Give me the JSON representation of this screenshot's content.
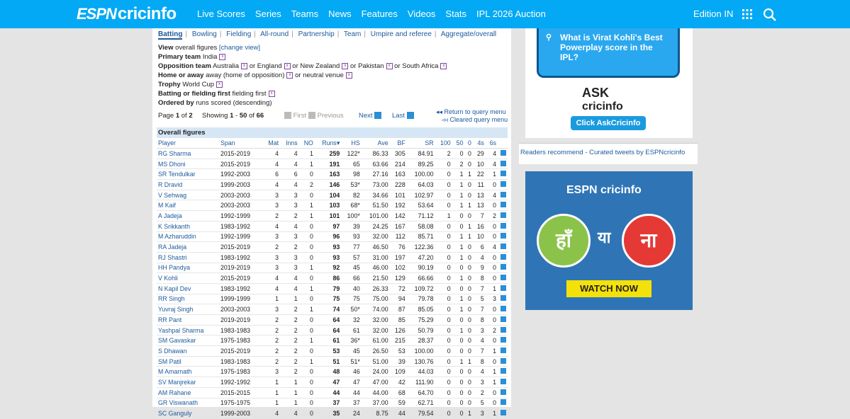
{
  "header": {
    "logo_espn": "ESPN",
    "logo_cricinfo": "cricinfo",
    "nav": [
      "Live Scores",
      "Series",
      "Teams",
      "News",
      "Features",
      "Videos",
      "Stats",
      "IPL 2026 Auction"
    ],
    "edition": "Edition IN"
  },
  "subnav": [
    "Batting",
    "Bowling",
    "Fielding",
    "All-round",
    "Partnership",
    "Team",
    "Umpire and referee",
    "Aggregate/overall"
  ],
  "query": {
    "view_label": "View",
    "view_value": "overall figures",
    "change_view": "[change view]",
    "primary_label": "Primary team",
    "primary_value": "India",
    "opp_label": "Opposition team",
    "opp_1": "Australia",
    "opp_2": "or England",
    "opp_3": "or New Zealand",
    "opp_4": "or Pakistan",
    "opp_5": "or South Africa",
    "home_label": "Home or away",
    "home_1": "away (home of opposition)",
    "home_2": "or neutral venue",
    "trophy_label": "Trophy",
    "trophy_value": "World Cup",
    "bf_label": "Batting or fielding first",
    "bf_value": "fielding first",
    "order_label": "Ordered by",
    "order_value": "runs scored (descending)"
  },
  "pager": {
    "page_label": "Page",
    "page": "1",
    "of": "of",
    "total_pages": "2",
    "showing": "Showing",
    "from": "1",
    "dash": "-",
    "to": "50",
    "of2": "of",
    "total": "66",
    "first": "First",
    "previous": "Previous",
    "next": "Next",
    "last": "Last",
    "return": "Return to query menu",
    "cleared": "Cleared query menu"
  },
  "table": {
    "section_title": "Overall figures",
    "columns": [
      "Player",
      "Span",
      "Mat",
      "Inns",
      "NO",
      "Runs",
      "HS",
      "Ave",
      "BF",
      "SR",
      "100",
      "50",
      "0",
      "4s",
      "6s"
    ],
    "rows": [
      [
        "RG Sharma",
        "2015-2019",
        "4",
        "4",
        "1",
        "259",
        "122*",
        "86.33",
        "305",
        "84.91",
        "2",
        "0",
        "0",
        "29",
        "4"
      ],
      [
        "MS Dhoni",
        "2015-2019",
        "4",
        "4",
        "1",
        "191",
        "65",
        "63.66",
        "214",
        "89.25",
        "0",
        "2",
        "0",
        "10",
        "4"
      ],
      [
        "SR Tendulkar",
        "1992-2003",
        "6",
        "6",
        "0",
        "163",
        "98",
        "27.16",
        "163",
        "100.00",
        "0",
        "1",
        "1",
        "22",
        "1"
      ],
      [
        "R Dravid",
        "1999-2003",
        "4",
        "4",
        "2",
        "146",
        "53*",
        "73.00",
        "228",
        "64.03",
        "0",
        "1",
        "0",
        "11",
        "0"
      ],
      [
        "V Sehwag",
        "2003-2003",
        "3",
        "3",
        "0",
        "104",
        "82",
        "34.66",
        "101",
        "102.97",
        "0",
        "1",
        "0",
        "13",
        "4"
      ],
      [
        "M Kaif",
        "2003-2003",
        "3",
        "3",
        "1",
        "103",
        "68*",
        "51.50",
        "192",
        "53.64",
        "0",
        "1",
        "1",
        "13",
        "0"
      ],
      [
        "A Jadeja",
        "1992-1999",
        "2",
        "2",
        "1",
        "101",
        "100*",
        "101.00",
        "142",
        "71.12",
        "1",
        "0",
        "0",
        "7",
        "2"
      ],
      [
        "K Srikkanth",
        "1983-1992",
        "4",
        "4",
        "0",
        "97",
        "39",
        "24.25",
        "167",
        "58.08",
        "0",
        "0",
        "1",
        "16",
        "0"
      ],
      [
        "M Azharuddin",
        "1992-1999",
        "3",
        "3",
        "0",
        "96",
        "93",
        "32.00",
        "112",
        "85.71",
        "0",
        "1",
        "1",
        "10",
        "0"
      ],
      [
        "RA Jadeja",
        "2015-2019",
        "2",
        "2",
        "0",
        "93",
        "77",
        "46.50",
        "76",
        "122.36",
        "0",
        "1",
        "0",
        "6",
        "4"
      ],
      [
        "RJ Shastri",
        "1983-1992",
        "3",
        "3",
        "0",
        "93",
        "57",
        "31.00",
        "197",
        "47.20",
        "0",
        "1",
        "0",
        "4",
        "0"
      ],
      [
        "HH Pandya",
        "2019-2019",
        "3",
        "3",
        "1",
        "92",
        "45",
        "46.00",
        "102",
        "90.19",
        "0",
        "0",
        "0",
        "9",
        "0"
      ],
      [
        "V Kohli",
        "2015-2019",
        "4",
        "4",
        "0",
        "86",
        "66",
        "21.50",
        "129",
        "66.66",
        "0",
        "1",
        "0",
        "8",
        "0"
      ],
      [
        "N Kapil Dev",
        "1983-1992",
        "4",
        "4",
        "1",
        "79",
        "40",
        "26.33",
        "72",
        "109.72",
        "0",
        "0",
        "0",
        "7",
        "1"
      ],
      [
        "RR Singh",
        "1999-1999",
        "1",
        "1",
        "0",
        "75",
        "75",
        "75.00",
        "94",
        "79.78",
        "0",
        "1",
        "0",
        "5",
        "3"
      ],
      [
        "Yuvraj Singh",
        "2003-2003",
        "3",
        "2",
        "1",
        "74",
        "50*",
        "74.00",
        "87",
        "85.05",
        "0",
        "1",
        "0",
        "7",
        "0"
      ],
      [
        "RR Pant",
        "2019-2019",
        "2",
        "2",
        "0",
        "64",
        "32",
        "32.00",
        "85",
        "75.29",
        "0",
        "0",
        "0",
        "8",
        "0"
      ],
      [
        "Yashpal Sharma",
        "1983-1983",
        "2",
        "2",
        "0",
        "64",
        "61",
        "32.00",
        "126",
        "50.79",
        "0",
        "1",
        "0",
        "3",
        "2"
      ],
      [
        "SM Gavaskar",
        "1975-1983",
        "2",
        "2",
        "1",
        "61",
        "36*",
        "61.00",
        "215",
        "28.37",
        "0",
        "0",
        "0",
        "4",
        "0"
      ],
      [
        "S Dhawan",
        "2015-2019",
        "2",
        "2",
        "0",
        "53",
        "45",
        "26.50",
        "53",
        "100.00",
        "0",
        "0",
        "0",
        "7",
        "1"
      ],
      [
        "SM Patil",
        "1983-1983",
        "2",
        "2",
        "1",
        "51",
        "51*",
        "51.00",
        "39",
        "130.76",
        "0",
        "1",
        "1",
        "8",
        "0"
      ],
      [
        "M Amarnath",
        "1975-1983",
        "3",
        "2",
        "0",
        "48",
        "46",
        "24.00",
        "109",
        "44.03",
        "0",
        "0",
        "0",
        "4",
        "1"
      ],
      [
        "SV Manjrekar",
        "1992-1992",
        "1",
        "1",
        "0",
        "47",
        "47",
        "47.00",
        "42",
        "111.90",
        "0",
        "0",
        "0",
        "3",
        "1"
      ],
      [
        "AM Rahane",
        "2015-2015",
        "1",
        "1",
        "0",
        "44",
        "44",
        "44.00",
        "68",
        "64.70",
        "0",
        "0",
        "0",
        "2",
        "0"
      ],
      [
        "GR Viswanath",
        "1975-1975",
        "1",
        "1",
        "0",
        "37",
        "37",
        "37.00",
        "59",
        "62.71",
        "0",
        "0",
        "0",
        "5",
        "0"
      ],
      [
        "SC Ganguly",
        "1999-2003",
        "4",
        "4",
        "0",
        "35",
        "24",
        "8.75",
        "44",
        "79.54",
        "0",
        "0",
        "1",
        "3",
        "1"
      ]
    ]
  },
  "ads": {
    "ask_question": "What is Virat Kohli's Best Powerplay score in the IPL?",
    "ask_brand_1": "ASK",
    "ask_brand_2": "cricinfo",
    "ask_button": "Click AskCricinfo",
    "readers": "Readers recommend - Curated tweets by ESPNcricinfo",
    "ad2_logo": "ESPN cricinfo",
    "ad2_left": "हाँ",
    "ad2_mid": "या",
    "ad2_right": "ना",
    "ad2_button": "WATCH NOW"
  }
}
